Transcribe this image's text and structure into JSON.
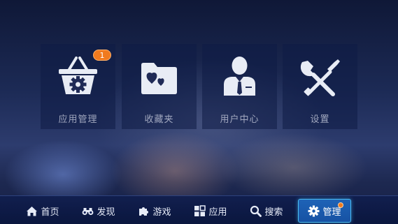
{
  "tiles": [
    {
      "label": "应用管理",
      "icon": "basket-gear-icon",
      "badge": "1"
    },
    {
      "label": "收藏夹",
      "icon": "heart-folder-icon"
    },
    {
      "label": "用户中心",
      "icon": "user-icon"
    },
    {
      "label": "设置",
      "icon": "wrench-screwdriver-icon"
    }
  ],
  "nav": {
    "items": [
      {
        "label": "首页",
        "icon": "home-icon"
      },
      {
        "label": "发现",
        "icon": "binoculars-icon"
      },
      {
        "label": "游戏",
        "icon": "puzzle-icon"
      },
      {
        "label": "应用",
        "icon": "grid-icon"
      },
      {
        "label": "搜索",
        "icon": "search-icon"
      },
      {
        "label": "管理",
        "icon": "gear-icon",
        "active": true,
        "dot": true
      }
    ]
  },
  "colors": {
    "tile_icon": "#e8ecf5",
    "badge": "#f07a1e",
    "active_nav": "#1e63b7",
    "active_border": "#4bbcf0"
  }
}
